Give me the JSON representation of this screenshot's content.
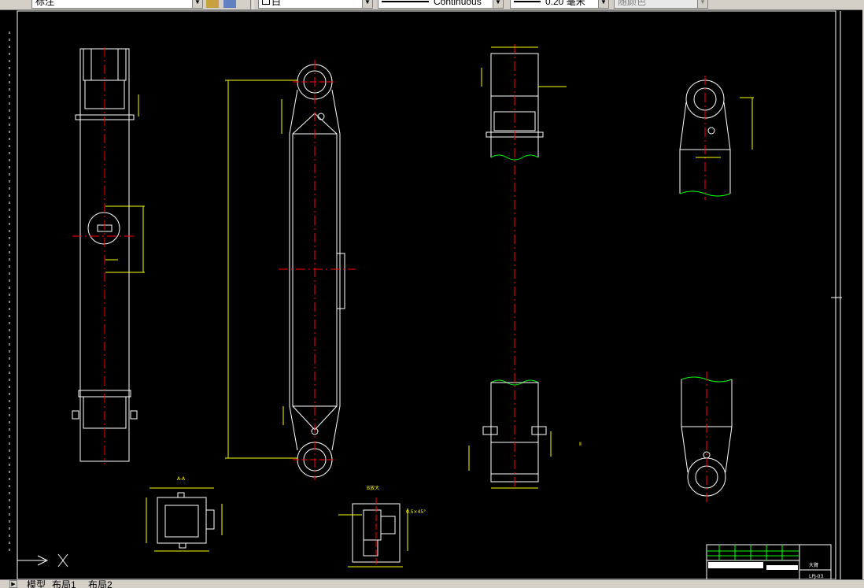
{
  "toolbar": {
    "text_style": "标注",
    "color": "白",
    "linetype": "Continuous",
    "lineweight": "0.20 毫米",
    "plotstyle": "随颜色"
  },
  "tabs": {
    "model": "模型",
    "layout1": "布局1",
    "layout2": "布局2"
  },
  "drawing": {
    "section_label": "A-A",
    "detail_label": "B放大",
    "chamfer_note": "0.5×45°",
    "title_block_name": "大臂",
    "title_block_code": "LPJ-03",
    "detail_ref": "Ⅱ"
  },
  "colors": {
    "background": "#000000",
    "outline": "#ffffff",
    "dimension": "#ffff00",
    "centerline": "#ff0000",
    "break_line": "#00ff00"
  }
}
